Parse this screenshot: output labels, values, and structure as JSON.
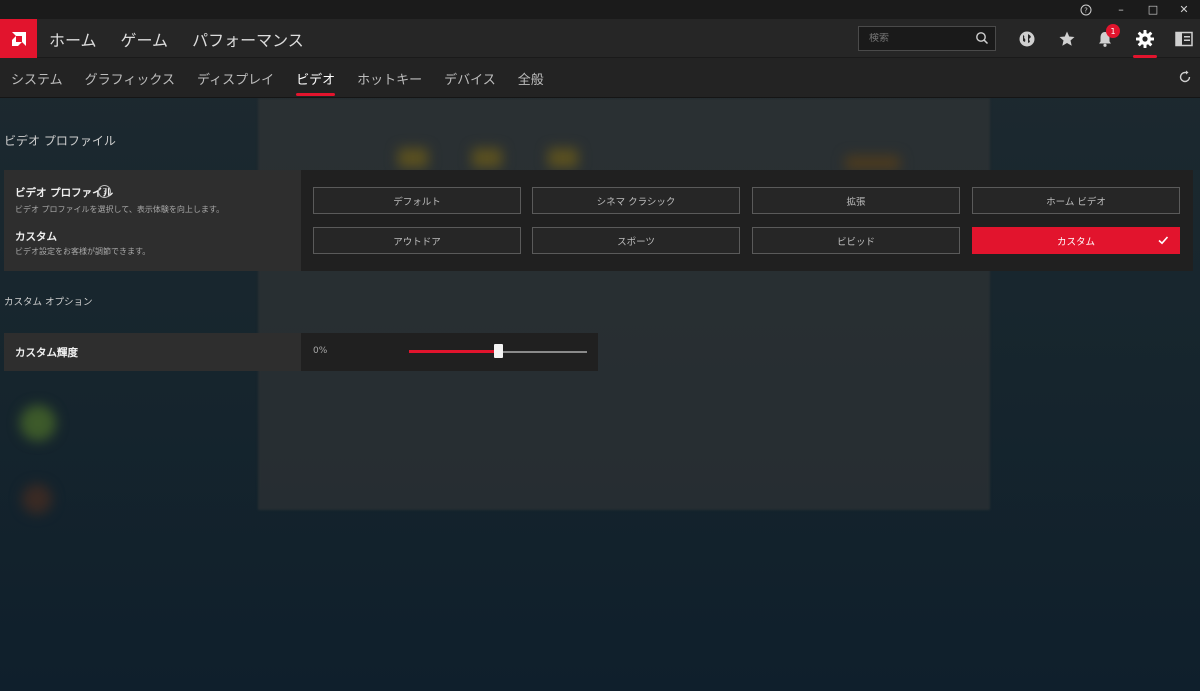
{
  "window": {
    "help_glyph": "?",
    "minimize_glyph": "–",
    "maximize_glyph": "□",
    "close_glyph": "✕"
  },
  "topnav": {
    "items": [
      "ホーム",
      "ゲーム",
      "パフォーマンス"
    ],
    "search_placeholder": "検索",
    "notification_count": "1",
    "icons": [
      "globe-icon",
      "star-icon",
      "bell-icon",
      "gear-icon",
      "sidebar-icon"
    ]
  },
  "subnav": {
    "tabs": [
      "システム",
      "グラフィックス",
      "ディスプレイ",
      "ビデオ",
      "ホットキー",
      "デバイス",
      "全般"
    ],
    "active_tab": "ビデオ"
  },
  "video_profile_section": {
    "title": "ビデオ プロファイル",
    "label": "ビデオ プロファイル",
    "help": "?",
    "description": "ビデオ プロファイルを選択して、表示体験を向上します。",
    "custom_label": "カスタム",
    "custom_description": "ビデオ設定をお客様が調節できます。",
    "options": [
      "デフォルト",
      "シネマ クラシック",
      "拡張",
      "ホーム ビデオ",
      "アウトドア",
      "スポーツ",
      "ビビッド",
      "カスタム"
    ],
    "selected": "カスタム"
  },
  "custom_options_section": {
    "title": "カスタム オプション",
    "brightness_label": "カスタム輝度",
    "brightness_value_text": "0%",
    "brightness_slider_fraction": 0.5
  },
  "colors": {
    "accent": "#e2142d",
    "panel": "#2e2e2e",
    "panel_dark": "#202020"
  }
}
